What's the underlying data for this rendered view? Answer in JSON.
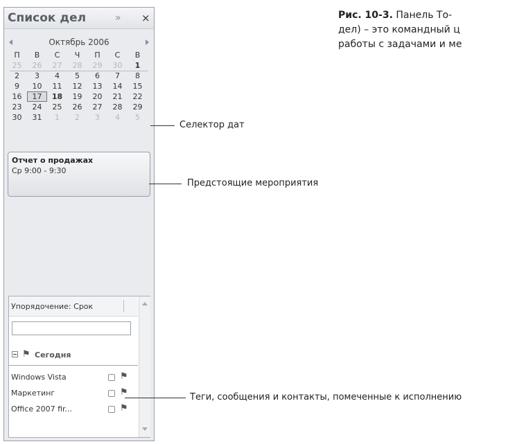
{
  "pane": {
    "title": "Список дел",
    "expand_icon": "»",
    "close_icon": "×"
  },
  "calendar": {
    "month_label": "Октябрь 2006",
    "weekdays": [
      "П",
      "В",
      "С",
      "Ч",
      "П",
      "С",
      "В"
    ],
    "weeks": [
      [
        "25",
        "26",
        "27",
        "28",
        "29",
        "30",
        "1"
      ],
      [
        "2",
        "3",
        "4",
        "5",
        "6",
        "7",
        "8"
      ],
      [
        "9",
        "10",
        "11",
        "12",
        "13",
        "14",
        "15"
      ],
      [
        "16",
        "17",
        "18",
        "19",
        "20",
        "21",
        "22"
      ],
      [
        "23",
        "24",
        "25",
        "26",
        "27",
        "28",
        "29"
      ],
      [
        "30",
        "31",
        "1",
        "2",
        "3",
        "4",
        "5"
      ]
    ],
    "selected_day": "17",
    "bold_day": "18"
  },
  "appointment": {
    "title": "Отчет о продажах",
    "time": "Ср 9:00 - 9:30"
  },
  "tasks": {
    "sort_label": "Упорядочение: Срок",
    "new_task_value": "",
    "group_label": "Сегодня",
    "items": [
      {
        "label": "Windows Vista"
      },
      {
        "label": "Маркетинг"
      },
      {
        "label": "Office 2007 fir..."
      }
    ]
  },
  "callouts": {
    "date_selector": "Селектор дат",
    "upcoming": "Предстоящие мероприятия",
    "tags": "Теги, сообщения и контакты, помеченные к исполнению"
  },
  "caption": {
    "figure": "Рис. 10-3.",
    "line1": "Панель То-",
    "line2": "дел) – это командный ц",
    "line3": "работы с задачами и ме"
  },
  "colors": {
    "pane_background": "#e9ebee",
    "border": "#9aa0a8",
    "title_text": "#5a5f66"
  }
}
